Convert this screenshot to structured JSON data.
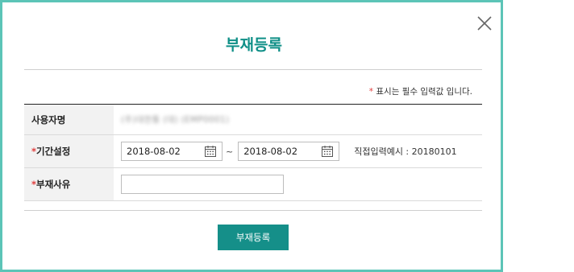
{
  "dialog": {
    "title": "부재등록",
    "close_icon": "close-icon"
  },
  "notice": {
    "mark": "*",
    "text": " 표시는 필수 입력값 입니다."
  },
  "form": {
    "user_name_label": "사용자명",
    "user_name_value": "(주)대한통 (대) (EMP0001)",
    "period_label_mark": "*",
    "period_label": "기간설정",
    "start_date": "2018-08-02",
    "end_date": "2018-08-02",
    "separator": "~",
    "calendar_icon": "calendar-icon",
    "example_text": "직접입력예시 : 20180101",
    "reason_label_mark": "*",
    "reason_label": "부재사유",
    "reason_value": ""
  },
  "actions": {
    "submit_label": "부재등록"
  },
  "colors": {
    "border": "#5cc4b7",
    "title": "#0f8f87",
    "button": "#158f89",
    "required": "#e03c3c"
  }
}
